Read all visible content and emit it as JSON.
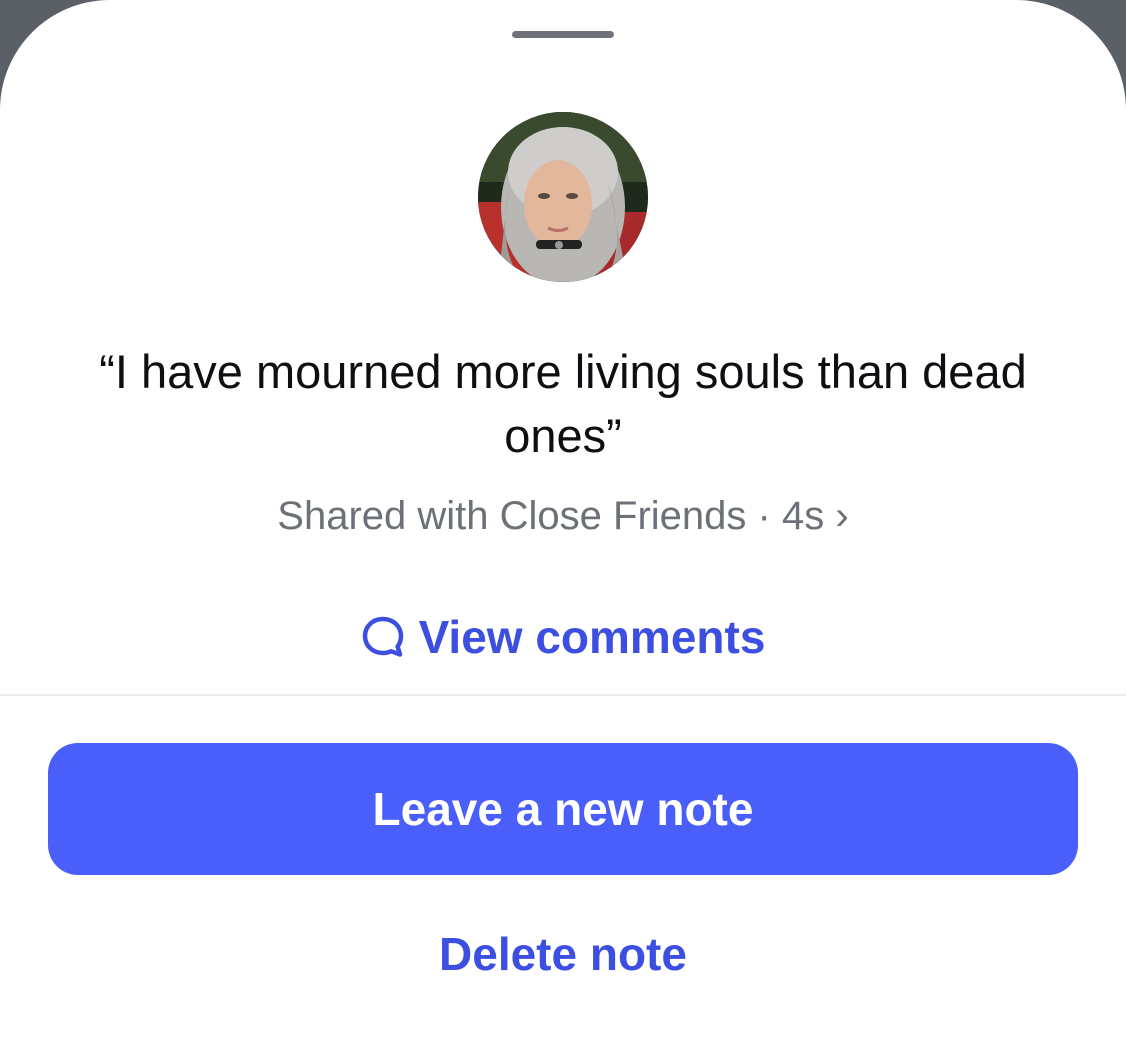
{
  "note": {
    "text": "“I have mourned more living souls than dead ones”",
    "shared_with": "Shared with Close Friends",
    "separator": "·",
    "age": "4s",
    "chevron": "›"
  },
  "actions": {
    "view_comments_label": "View comments",
    "view_comments_icon": "comment-bubble-icon",
    "leave_note_label": "Leave a new note",
    "delete_note_label": "Delete note"
  },
  "colors": {
    "accent": "#3d4fe0",
    "primary_button": "#4a5ffa",
    "secondary_text": "#6c7178",
    "primary_text": "#0e0f12"
  }
}
